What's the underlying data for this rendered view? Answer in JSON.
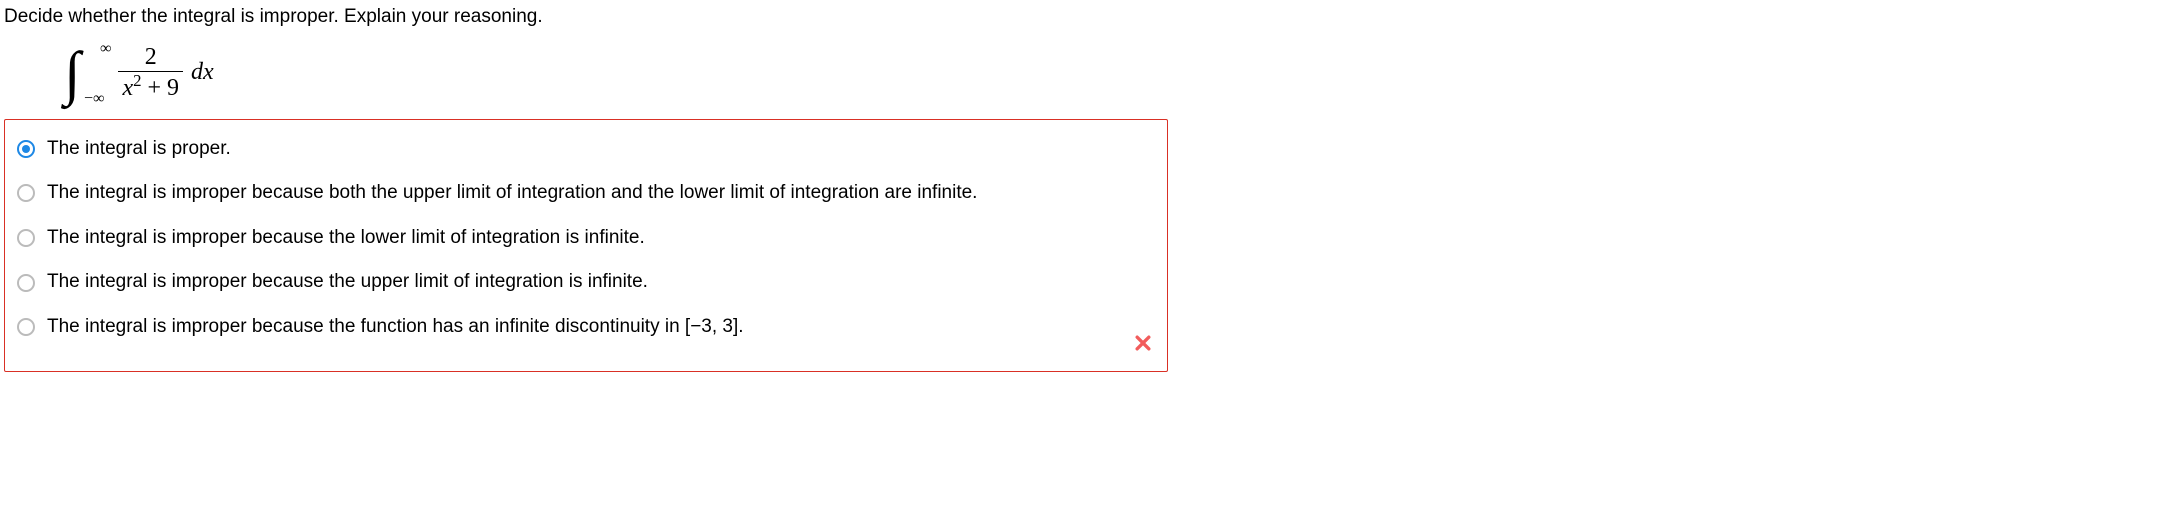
{
  "question": {
    "prompt": "Decide whether the integral is improper. Explain your reasoning.",
    "integral": {
      "upper_limit": "∞",
      "lower_limit": "−∞",
      "numerator": "2",
      "denominator_var": "x",
      "denominator_exp": "2",
      "denominator_rest": " + 9",
      "differential": "dx"
    }
  },
  "options": [
    "The integral is proper.",
    "The integral is improper because both the upper limit of integration and the lower limit of integration are infinite.",
    "The integral is improper because the lower limit of integration is infinite.",
    "The integral is improper because the upper limit of integration is infinite.",
    "The integral is improper because the function has an infinite discontinuity in [−3, 3]."
  ],
  "selected_index": 0,
  "feedback": "incorrect"
}
